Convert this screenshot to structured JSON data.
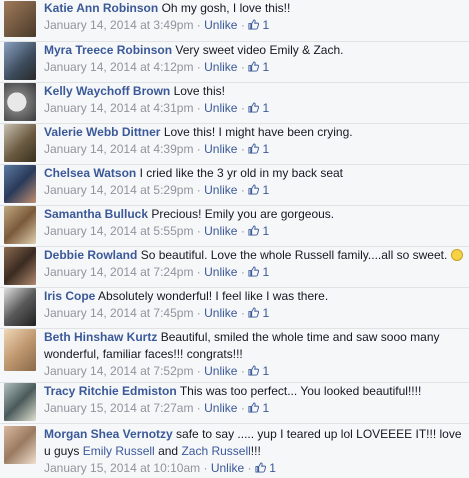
{
  "ui": {
    "unlike_label": "Unlike",
    "separator": "·"
  },
  "comments": [
    {
      "name": "Katie Ann Robinson",
      "text": "Oh my gosh, I love this!!",
      "time": "January 14, 2014 at 3:49pm",
      "likes": "1"
    },
    {
      "name": "Myra Treece Robinson",
      "text": "Very sweet video Emily & Zach.",
      "time": "January 14, 2014 at 4:12pm",
      "likes": "1"
    },
    {
      "name": "Kelly Waychoff Brown",
      "text": "Love this!",
      "time": "January 14, 2014 at 4:31pm",
      "likes": "1"
    },
    {
      "name": "Valerie Webb Dittner",
      "text": "Love this! I might have been crying.",
      "time": "January 14, 2014 at 4:39pm",
      "likes": "1"
    },
    {
      "name": "Chelsea Watson",
      "text": "I cried like the 3 yr old in my back seat",
      "time": "January 14, 2014 at 5:29pm",
      "likes": "1"
    },
    {
      "name": "Samantha Bulluck",
      "text": "Precious! Emily you are gorgeous.",
      "time": "January 14, 2014 at 5:55pm",
      "likes": "1"
    },
    {
      "name": "Debbie Rowland",
      "text": "So beautiful. Love the whole Russell family....all so sweet.",
      "time": "January 14, 2014 at 7:24pm",
      "likes": "1"
    },
    {
      "name": "Iris Cope",
      "text": "Absolutely wonderful! I feel like I was there.",
      "time": "January 14, 2014 at 7:45pm",
      "likes": "1"
    },
    {
      "name": "Beth Hinshaw Kurtz",
      "text": "Beautiful, smiled the whole time and saw sooo many wonderful, familiar faces!!! congrats!!!",
      "time": "January 14, 2014 at 7:52pm",
      "likes": "1"
    },
    {
      "name": "Tracy Ritchie Edmiston",
      "text": "This was too perfect... You looked beautiful!!!!",
      "time": "January 15, 2014 at 7:27am",
      "likes": "1"
    },
    {
      "name": "Morgan Shea Vernotzy",
      "text": "safe to say ..... yup I teared up lol LOVEEEE IT!!! love u guys",
      "mention1": "Emily Russell",
      "and": "and",
      "mention2": "Zach Russell",
      "tail": "!!!",
      "time": "January 15, 2014 at 10:10am",
      "likes": "1"
    }
  ],
  "avatar_colors": [
    "#6b4a3a",
    "#5a6f8a",
    "#9a9a9a",
    "#7a6a52",
    "#4a5a7a",
    "#8a7a5a",
    "#6a5a4a",
    "#555555",
    "#c9a880",
    "#7a8a8a",
    "#b89a80"
  ]
}
